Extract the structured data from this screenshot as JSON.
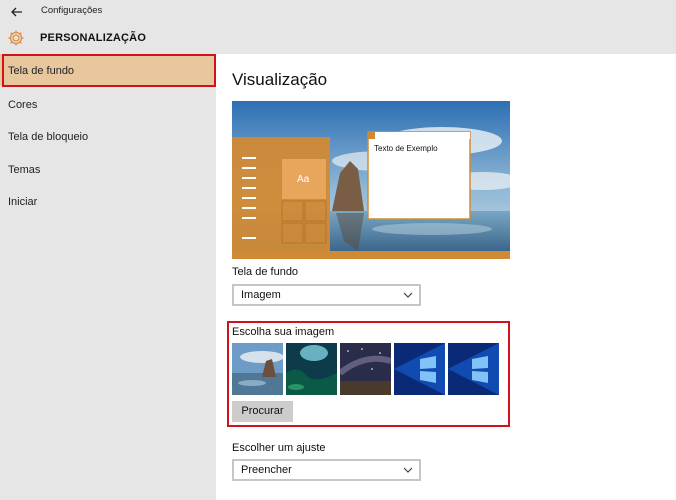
{
  "window": {
    "title": "Configurações",
    "icons": {
      "back": "arrow-left-icon",
      "settings": "gear-icon"
    }
  },
  "header": {
    "title": "PERSONALIZAÇÃO",
    "accent_color": "#e38d3a"
  },
  "sidebar": {
    "items": [
      {
        "label": "Tela de fundo",
        "selected": true
      },
      {
        "label": "Cores",
        "selected": false
      },
      {
        "label": "Tela de bloqueio",
        "selected": false
      },
      {
        "label": "Temas",
        "selected": false
      },
      {
        "label": "Iniciar",
        "selected": false
      }
    ],
    "selected_color": "#e8c79f",
    "highlight_color": "#d0121b"
  },
  "main": {
    "title": "Visualização",
    "preview": {
      "tile_text": "Aa",
      "window_text": "Texto de Exemplo",
      "accent_color": "#d08a35"
    },
    "background": {
      "label": "Tela de fundo",
      "value": "Imagem"
    },
    "choose_image": {
      "label": "Escolha sua imagem",
      "thumbnails": [
        "beach-rock-image",
        "underwater-image",
        "night-sky-image",
        "windows-logo-blue-image",
        "windows-logo-blue-image"
      ],
      "browse_label": "Procurar"
    },
    "fit": {
      "label": "Escolher um ajuste",
      "value": "Preencher"
    }
  }
}
